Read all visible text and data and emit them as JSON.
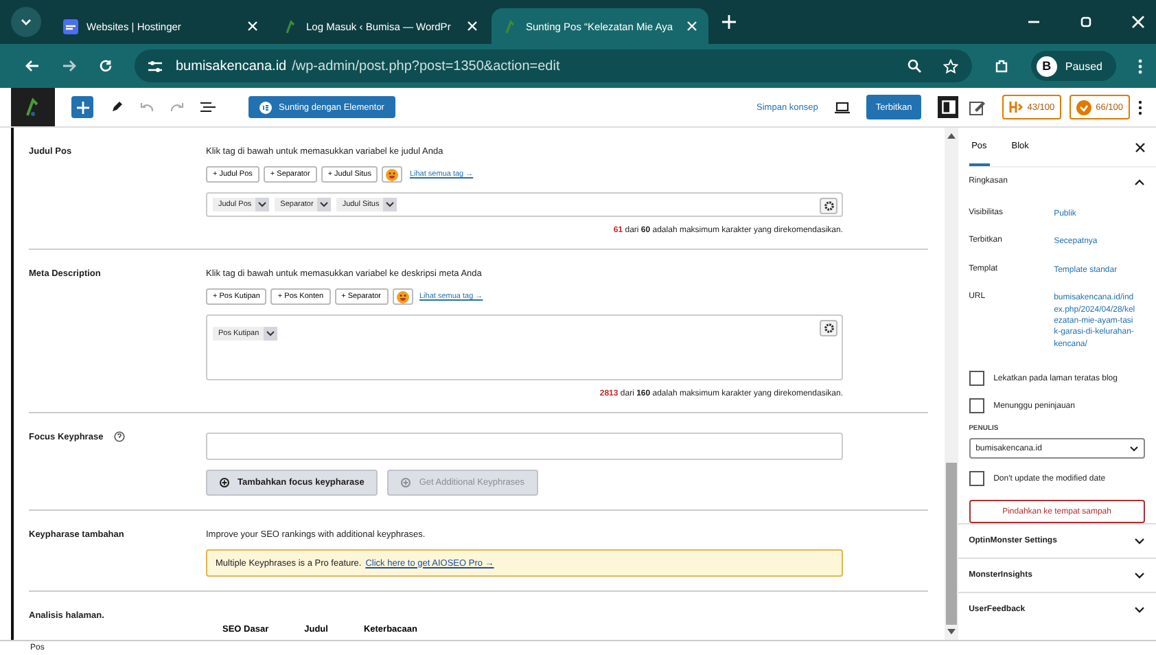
{
  "browser": {
    "tabs": [
      {
        "title": "Websites | Hostinger",
        "selected": false
      },
      {
        "title": "Log Masuk ‹ Bumisa — WordPr",
        "selected": false
      },
      {
        "title": "Sunting Pos “Kelezatan Mie Aya",
        "selected": true
      }
    ],
    "address_host": "bumisakencana.id",
    "address_path": "/wp-admin/post.php?post=1350&action=edit",
    "profile_initial": "B",
    "profile_status": "Paused"
  },
  "toolbar": {
    "elementor_button": "Sunting dengan Elementor",
    "save_draft": "Simpan konsep",
    "publish": "Terbitkan",
    "scores": [
      {
        "kind": "headline",
        "value": "43/100"
      },
      {
        "kind": "truseo",
        "value": "66/100"
      }
    ]
  },
  "seo": {
    "title_section": {
      "label": "Judul Pos",
      "hint": "Klik tag di bawah untuk memasukkan variabel ke judul Anda",
      "tag_buttons": [
        "+ Judul Pos",
        "+ Separator",
        "+ Judul Situs"
      ],
      "see_all": "Lihat semua tag →",
      "tokens": [
        "Judul Pos",
        "Separator",
        "Judul Situs"
      ],
      "count": "61",
      "count_rest": " dari ",
      "max": "60",
      "count_tail": " adalah maksimum karakter yang direkomendasikan."
    },
    "description_section": {
      "label": "Meta Description",
      "hint": "Klik tag di bawah untuk memasukkan variabel ke deskripsi meta Anda",
      "tag_buttons": [
        "+ Pos Kutipan",
        "+ Pos Konten",
        "+ Separator"
      ],
      "see_all": "Lihat semua tag →",
      "tokens": [
        "Pos Kutipan"
      ],
      "count": "2813",
      "count_rest": " dari ",
      "max": "160",
      "count_tail": " adalah maksimum karakter yang direkomendasikan."
    },
    "focus": {
      "label": "Focus Keyphrase",
      "add_button": "Tambahkan focus keypharase",
      "additional_button": "Get Additional Keyphrases",
      "additional_disabled": true
    },
    "additional": {
      "label": "Keypharase tambahan",
      "text": "Improve your SEO rankings with additional keyphrases.",
      "notice": "Multiple Keyphrases is a Pro feature.",
      "notice_link": "Click here to get AIOSEO Pro →"
    },
    "analysis": {
      "label": "Analisis halaman.",
      "tabs": [
        "SEO Dasar",
        "Judul",
        "Keterbacaan"
      ]
    }
  },
  "sidebar": {
    "tabs": [
      {
        "label": "Pos",
        "selected": true
      },
      {
        "label": "Blok",
        "selected": false
      }
    ],
    "summary_title": "Ringkasan",
    "expanded": true,
    "fields": [
      {
        "label": "Visibilitas",
        "value": "Publik"
      },
      {
        "label": "Terbitkan",
        "value": "Secepatnya"
      },
      {
        "label": "Templat",
        "value": "Template standar"
      },
      {
        "label": "URL",
        "value": "bumisakencana.id/index.php/2024/04/28/kelezatan-mie-ayam-tasik-garasi-di-kelurahan-kencana/"
      }
    ],
    "checkboxes": [
      {
        "label": "Lekatkan pada laman teratas blog",
        "checked": false
      },
      {
        "label": "Menunggu peninjauan",
        "checked": false
      }
    ],
    "author_label": "PENULIS",
    "author": "bumisakencana.id",
    "modified_checkbox": {
      "label": "Don't update the modified date",
      "checked": false
    },
    "trash_button": "Pindahkan ke tempat sampah",
    "panels": [
      {
        "title": "OptinMonster Settings",
        "expanded": false
      },
      {
        "title": "MonsterInsights",
        "expanded": false
      },
      {
        "title": "UserFeedback",
        "expanded": false
      }
    ]
  },
  "status_bar": "Pos"
}
